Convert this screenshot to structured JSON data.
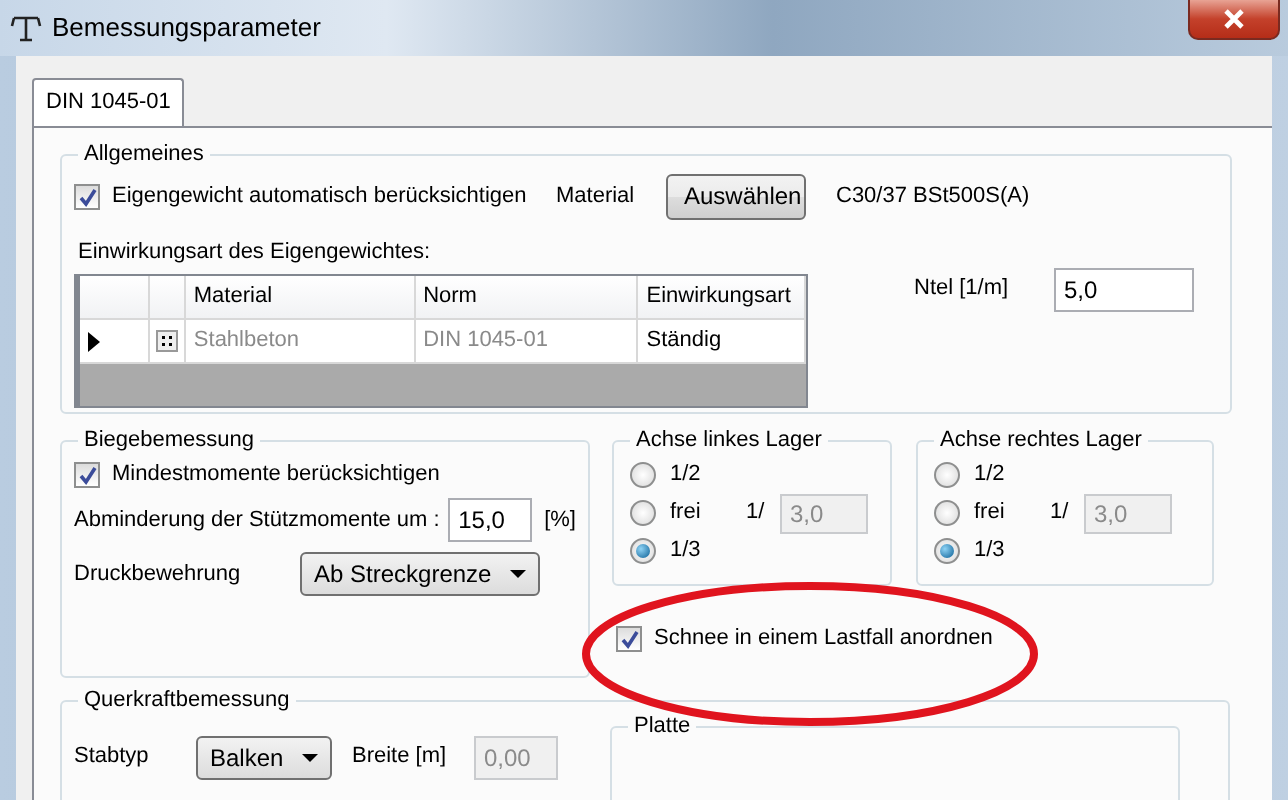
{
  "window": {
    "title": "Bemessungsparameter"
  },
  "tabs": [
    {
      "label": "DIN 1045-01",
      "selected": true
    }
  ],
  "general": {
    "title": "Allgemeines",
    "self_weight": {
      "label": "Eigengewicht automatisch berücksichtigen",
      "checked": true
    },
    "material_label": "Material",
    "select_button": "Auswählen",
    "material_value": "C30/37 BSt500S(A)",
    "grid_label": "Einwirkungsart des Eigengewichtes:",
    "grid": {
      "columns": [
        "Material",
        "Norm",
        "Einwirkungsart"
      ],
      "rows": [
        {
          "cells": [
            "Stahlbeton",
            "DIN 1045-01",
            "Ständig"
          ],
          "current": true
        }
      ]
    },
    "ntel": {
      "label": "Ntel [1/m]",
      "value": "5,0"
    }
  },
  "bending": {
    "title": "Biegebemessung",
    "min_moments": {
      "label": "Mindestmomente berücksichtigen",
      "checked": true
    },
    "reduction": {
      "label": "Abminderung der Stützmomente um :",
      "value": "15,0",
      "unit": "[%]"
    },
    "compression": {
      "label": "Druckbewehrung",
      "value": "Ab Streckgrenze"
    }
  },
  "axes": [
    {
      "title": "Achse linkes Lager",
      "options": [
        {
          "label": "1/2",
          "selected": false
        },
        {
          "label": "frei",
          "selected": false,
          "prefix": "1/",
          "value": "3,0",
          "disabled": true
        },
        {
          "label": "1/3",
          "selected": true
        }
      ]
    },
    {
      "title": "Achse rechtes Lager",
      "options": [
        {
          "label": "1/2",
          "selected": false
        },
        {
          "label": "frei",
          "selected": false,
          "prefix": "1/",
          "value": "3,0",
          "disabled": true
        },
        {
          "label": "1/3",
          "selected": true
        }
      ]
    }
  ],
  "snow": {
    "label": "Schnee in einem Lastfall anordnen",
    "checked": true
  },
  "shear": {
    "title": "Querkraftbemessung",
    "bar_type": {
      "label": "Stabtyp",
      "value": "Balken"
    },
    "width": {
      "label": "Breite [m]",
      "value": "0,00",
      "disabled": true
    },
    "plate": {
      "title": "Platte"
    }
  }
}
